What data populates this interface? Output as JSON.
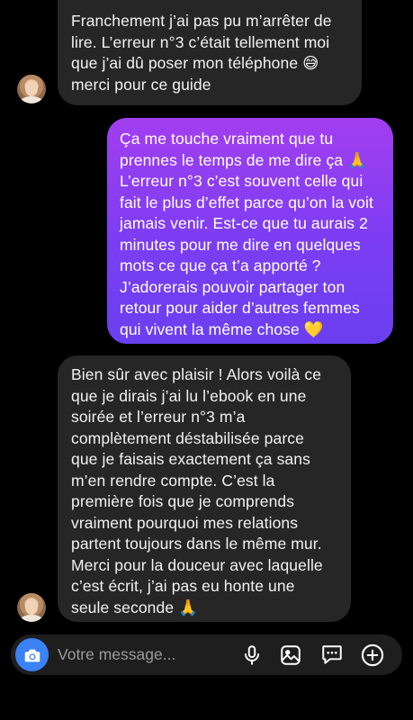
{
  "messages": [
    {
      "sender": "other",
      "text": "Franchement j’ai pas pu m’arrêter de\nlire. L’erreur n°3 c’était tellement moi\nque j’ai dû poser mon téléphone 😅\nmerci pour ce guide"
    },
    {
      "sender": "me",
      "text": "Ça me touche vraiment que tu\nprennes le temps de me dire ça 🙏\nL’erreur n°3 c’est souvent celle qui\nfait le plus d’effet parce qu’on la voit\njamais venir. Est-ce que tu aurais 2\nminutes pour me dire en quelques\nmots ce que ça t’a apporté ?\nJ’adorerais pouvoir partager ton\nretour pour aider d’autres femmes\nqui vivent la même chose 💛"
    },
    {
      "sender": "other",
      "text": "Bien sûr avec plaisir ! Alors voilà ce\nque je dirais j’ai lu l’ebook en une\nsoirée et l’erreur n°3 m’a\ncomplètement déstabilisée parce\nque je faisais exactement ça sans\nm’en rendre compte. C’est la\npremière fois que je comprends\nvraiment pourquoi mes relations\npartent toujours dans le même mur.\nMerci pour la douceur avec laquelle\nc’est écrit, j’ai pas eu honte une\nseule seconde 🙏"
    }
  ],
  "composer": {
    "placeholder": "Votre message..."
  },
  "colors": {
    "background": "#000000",
    "incoming_bubble": "#262626",
    "outgoing_gradient_start": "#a23ef0",
    "outgoing_gradient_end": "#6a3ff0",
    "camera_button": "#3b82f6"
  },
  "icons": [
    "camera-icon",
    "microphone-icon",
    "gallery-icon",
    "sticker-icon",
    "plus-circle-icon"
  ]
}
